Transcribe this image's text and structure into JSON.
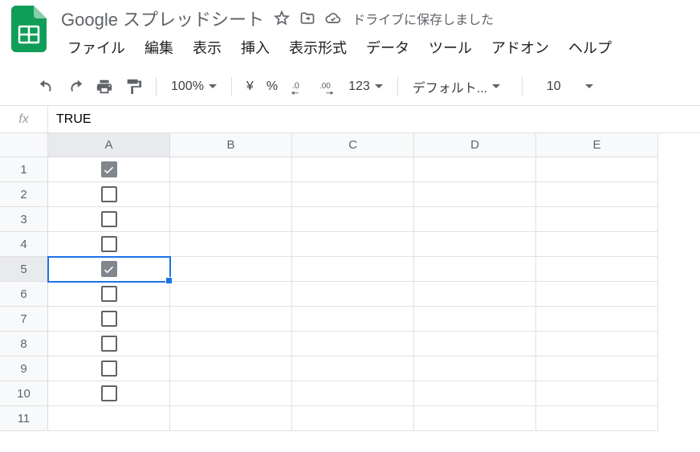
{
  "doc": {
    "title": "Google スプレッドシート",
    "save_status": "ドライブに保存しました"
  },
  "menu": {
    "file": "ファイル",
    "edit": "編集",
    "view": "表示",
    "insert": "挿入",
    "format": "表示形式",
    "data": "データ",
    "tools": "ツール",
    "addons": "アドオン",
    "help": "ヘルプ"
  },
  "toolbar": {
    "zoom": "100%",
    "currency": "¥",
    "percent": "%",
    "dec_dec": ".0",
    "inc_dec": ".00",
    "numfmt": "123",
    "font": "デフォルト...",
    "font_size": "10"
  },
  "formula": {
    "fx": "fx",
    "value": "TRUE"
  },
  "grid": {
    "columns": [
      "A",
      "B",
      "C",
      "D",
      "E"
    ],
    "rows": [
      "1",
      "2",
      "3",
      "4",
      "5",
      "6",
      "7",
      "8",
      "9",
      "10",
      "11"
    ],
    "checkboxes": [
      true,
      false,
      false,
      false,
      true,
      false,
      false,
      false,
      false,
      false
    ],
    "selected": {
      "row": 5,
      "col": "A"
    }
  }
}
